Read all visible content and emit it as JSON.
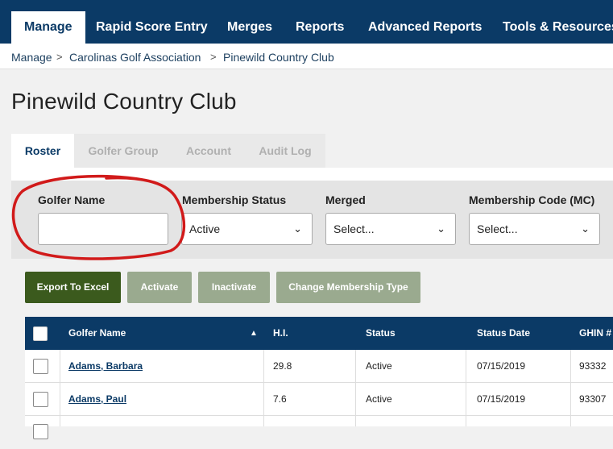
{
  "nav": {
    "items": [
      {
        "label": "Manage"
      },
      {
        "label": "Rapid Score Entry"
      },
      {
        "label": "Merges"
      },
      {
        "label": "Reports"
      },
      {
        "label": "Advanced Reports"
      },
      {
        "label": "Tools & Resources"
      }
    ]
  },
  "breadcrumb": {
    "items": [
      "Manage",
      "Carolinas Golf Association",
      "Pinewild Country Club"
    ],
    "separator": ">"
  },
  "page": {
    "title": "Pinewild Country Club"
  },
  "tabs": [
    "Roster",
    "Golfer Group",
    "Account",
    "Audit Log"
  ],
  "filters": {
    "golfer_name_label": "Golfer Name",
    "golfer_name_value": "",
    "membership_status_label": "Membership Status",
    "membership_status_value": "Active",
    "merged_label": "Merged",
    "merged_value": "Select...",
    "membership_code_label": "Membership Code (MC)",
    "membership_code_value": "Select..."
  },
  "actions": {
    "export": "Export To Excel",
    "activate": "Activate",
    "inactivate": "Inactivate",
    "change_type": "Change Membership Type"
  },
  "table": {
    "headers": [
      "Golfer Name",
      "H.I.",
      "Status",
      "Status Date",
      "GHIN #"
    ],
    "rows": [
      {
        "name": "Adams, Barbara",
        "hi": "29.8",
        "status": "Active",
        "date": "07/15/2019",
        "ghin": "93332"
      },
      {
        "name": "Adams, Paul",
        "hi": "7.6",
        "status": "Active",
        "date": "07/15/2019",
        "ghin": "93307"
      }
    ]
  },
  "colors": {
    "nav_bg": "#0b3a66",
    "primary_button": "#3b5a1d",
    "disabled_button": "#9aaa8f",
    "annotation": "#d11a1a"
  },
  "icons": {
    "sort": "sort-up-icon",
    "select_chevron": "chevron-down-icon"
  }
}
